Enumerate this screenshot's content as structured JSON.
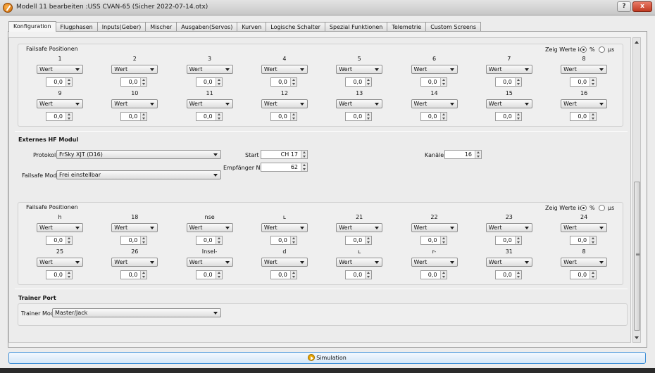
{
  "window": {
    "title": "Modell 11 bearbeiten :USS CVAN-65   (Sicher 2022-07-14.otx)",
    "help_label": "?",
    "close_label": "x"
  },
  "tabs": [
    "Konfiguration",
    "Flugphasen",
    "Inputs(Geber)",
    "Mischer",
    "Ausgaben(Servos)",
    "Kurven",
    "Logische Schalter",
    "Spezial Funktionen",
    "Telemetrie",
    "Custom Screens"
  ],
  "failsafe_top": {
    "title": "Failsafe Positionen",
    "show_values_label": "Zeig Werte in:",
    "unit_percent": "%",
    "unit_us": "µs",
    "row1_labels": [
      "1",
      "2",
      "3",
      "4",
      "5",
      "6",
      "7",
      "8"
    ],
    "row2_labels": [
      "9",
      "10",
      "11",
      "12",
      "13",
      "14",
      "15",
      "16"
    ],
    "mode_value": "Wert",
    "value": "0,0"
  },
  "external_module": {
    "title": "Externes HF Modul",
    "protocol_label": "Protokoll",
    "protocol_value": "FrSky XJT (D16)",
    "start_label": "Start",
    "start_value": "CH 17",
    "channels_label": "Kanäle",
    "channels_value": "16",
    "receiver_label": "Empfänger Nr.",
    "receiver_value": "62",
    "failsafe_mode_label": "Failsafe Mode",
    "failsafe_mode_value": "Frei einstellbar"
  },
  "failsafe_bottom": {
    "title": "Failsafe Positionen",
    "show_values_label": "Zeig Werte in:",
    "unit_percent": "%",
    "unit_us": "µs",
    "row1_labels": [
      "h",
      "18",
      "nse",
      "ʟ",
      "21",
      "22",
      "23",
      "24"
    ],
    "row2_labels": [
      "25",
      "26",
      "Insel-",
      "d",
      "ʟ",
      "r-",
      "31",
      "8"
    ],
    "mode_value": "Wert",
    "value": "0,0"
  },
  "trainer": {
    "title": "Trainer Port",
    "mode_label": "Trainer Mode",
    "mode_value": "Master/Jack"
  },
  "simulation_label": "Simulation"
}
